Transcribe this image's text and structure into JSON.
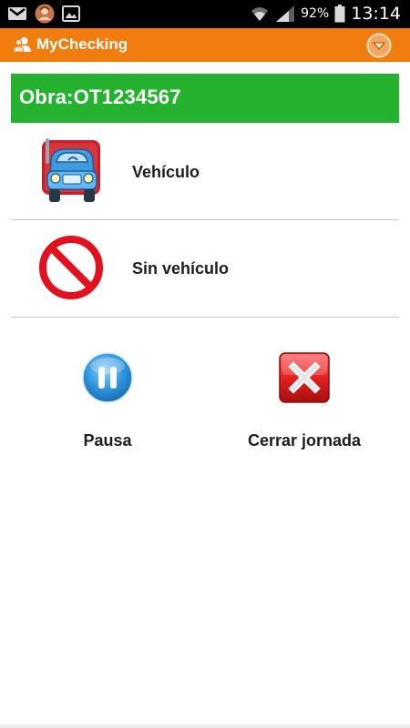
{
  "status_bar": {
    "battery_percent": "92%",
    "time": "13:14",
    "notification_icons": [
      "gmail-icon",
      "contact-avatar-icon",
      "gallery-icon"
    ],
    "system_icons": [
      "wifi-icon",
      "cell-signal-icon",
      "battery-icon"
    ]
  },
  "app_bar": {
    "title": "MyChecking",
    "logo_icon": "people-icon",
    "menu_icon": "chevron-down-circle-icon",
    "color": "#f07d0e"
  },
  "obra": {
    "text": "Obra:OT1234567",
    "color": "#24b22f"
  },
  "options": [
    {
      "label": "Vehículo",
      "icon": "truck-icon"
    },
    {
      "label": "Sin vehículo",
      "icon": "no-entry-icon"
    }
  ],
  "actions": {
    "pause": {
      "label": "Pausa",
      "icon": "pause-icon"
    },
    "close_day": {
      "label": "Cerrar jornada",
      "icon": "close-x-icon"
    }
  }
}
